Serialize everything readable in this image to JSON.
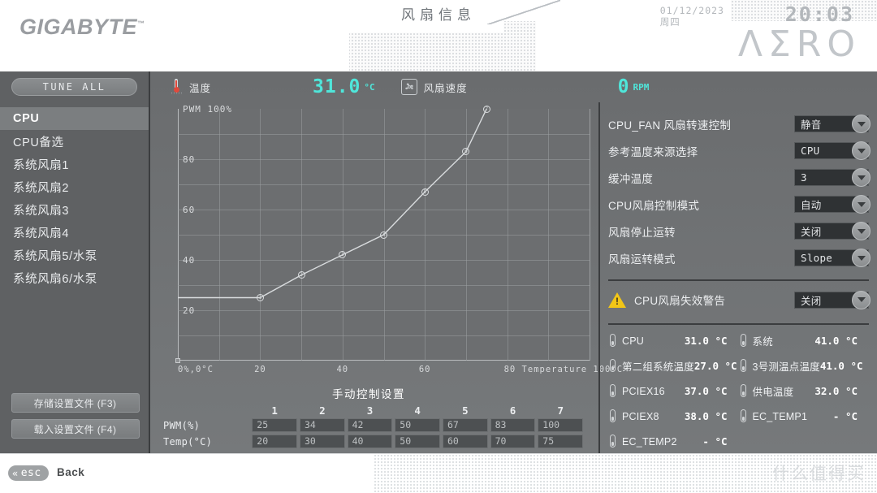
{
  "header": {
    "brand": "GIGABYTE",
    "brand_tm": "™",
    "title": "风扇信息",
    "date": "01/12/2023",
    "weekday": "周四",
    "time": "20:03",
    "logo": "ΛΣRO"
  },
  "status": {
    "temp_icon": "thermometer-icon",
    "temp_label": "温度",
    "temp_value": "31.0",
    "temp_unit": "°C",
    "fan_icon": "fan-icon",
    "fan_label": "风扇速度",
    "fan_value": "0",
    "fan_unit": "RPM",
    "accent_color": "#4fe6da"
  },
  "sidebar": {
    "tune_all": "TUNE ALL",
    "items": [
      {
        "label": "CPU",
        "active": true
      },
      {
        "label": "CPU备选",
        "active": false
      },
      {
        "label": "系统风扇1",
        "active": false
      },
      {
        "label": "系统风扇2",
        "active": false
      },
      {
        "label": "系统风扇3",
        "active": false
      },
      {
        "label": "系统风扇4",
        "active": false
      },
      {
        "label": "系统风扇5/水泵",
        "active": false
      },
      {
        "label": "系统风扇6/水泵",
        "active": false
      }
    ],
    "save_button": "存储设置文件 (F3)",
    "load_button": "载入设置文件 (F4)"
  },
  "chart_data": {
    "type": "line",
    "title": "",
    "xlabel": "Temperature",
    "ylabel": "PWM",
    "x_axis_origin_label": "0%,0°C",
    "x_tick_labels": [
      "20",
      "40",
      "60",
      "80"
    ],
    "x_end_label": "Temperature 100°C",
    "y_top_label": "PWM 100%",
    "y_tick_labels": [
      "80",
      "60",
      "40",
      "20"
    ],
    "xlim": [
      0,
      100
    ],
    "ylim": [
      0,
      100
    ],
    "grid": true,
    "legend": "none",
    "points": [
      {
        "index": "1",
        "temp": 20,
        "pwm": 25
      },
      {
        "index": "2",
        "temp": 30,
        "pwm": 34
      },
      {
        "index": "3",
        "temp": 40,
        "pwm": 42
      },
      {
        "index": "4",
        "temp": 50,
        "pwm": 50
      },
      {
        "index": "5",
        "temp": 60,
        "pwm": 67
      },
      {
        "index": "6",
        "temp": 70,
        "pwm": 83
      },
      {
        "index": "7",
        "temp": 75,
        "pwm": 100
      }
    ],
    "line_color": "#d9dcde"
  },
  "manual": {
    "title": "手动控制设置",
    "columns": [
      "1",
      "2",
      "3",
      "4",
      "5",
      "6",
      "7"
    ],
    "rows": [
      {
        "label": "PWM(%)",
        "values": [
          "25",
          "34",
          "42",
          "50",
          "67",
          "83",
          "100"
        ]
      },
      {
        "label": "Temp(°C)",
        "values": [
          "20",
          "30",
          "40",
          "50",
          "60",
          "70",
          "75"
        ]
      }
    ]
  },
  "settings": {
    "rows": [
      {
        "label": "CPU_FAN 风扇转速控制",
        "value": "静音"
      },
      {
        "label": "参考温度来源选择",
        "value": "CPU"
      },
      {
        "label": "缓冲温度",
        "value": "3"
      },
      {
        "label": "CPU风扇控制模式",
        "value": "自动"
      },
      {
        "label": "风扇停止运转",
        "value": "关闭"
      },
      {
        "label": "风扇运转模式",
        "value": "Slope"
      }
    ],
    "warning": {
      "icon": "warning-triangle-icon",
      "label": "CPU风扇失效警告",
      "value": "关闭",
      "color": "#f2c617"
    }
  },
  "sensors": [
    {
      "name": "CPU",
      "value": "31.0 °C"
    },
    {
      "name": "系统",
      "value": "41.0 °C"
    },
    {
      "name": "第二组系统温度",
      "value": "27.0 °C"
    },
    {
      "name": "3号测温点温度",
      "value": "41.0 °C"
    },
    {
      "name": "PCIEX16",
      "value": "37.0 °C"
    },
    {
      "name": "供电温度",
      "value": "32.0 °C"
    },
    {
      "name": "PCIEX8",
      "value": "38.0 °C"
    },
    {
      "name": "EC_TEMP1",
      "value": "- °C"
    },
    {
      "name": "EC_TEMP2",
      "value": "- °C"
    }
  ],
  "footer": {
    "esc_key": "esc",
    "back_label": "Back",
    "watermark": "什么值得买"
  }
}
